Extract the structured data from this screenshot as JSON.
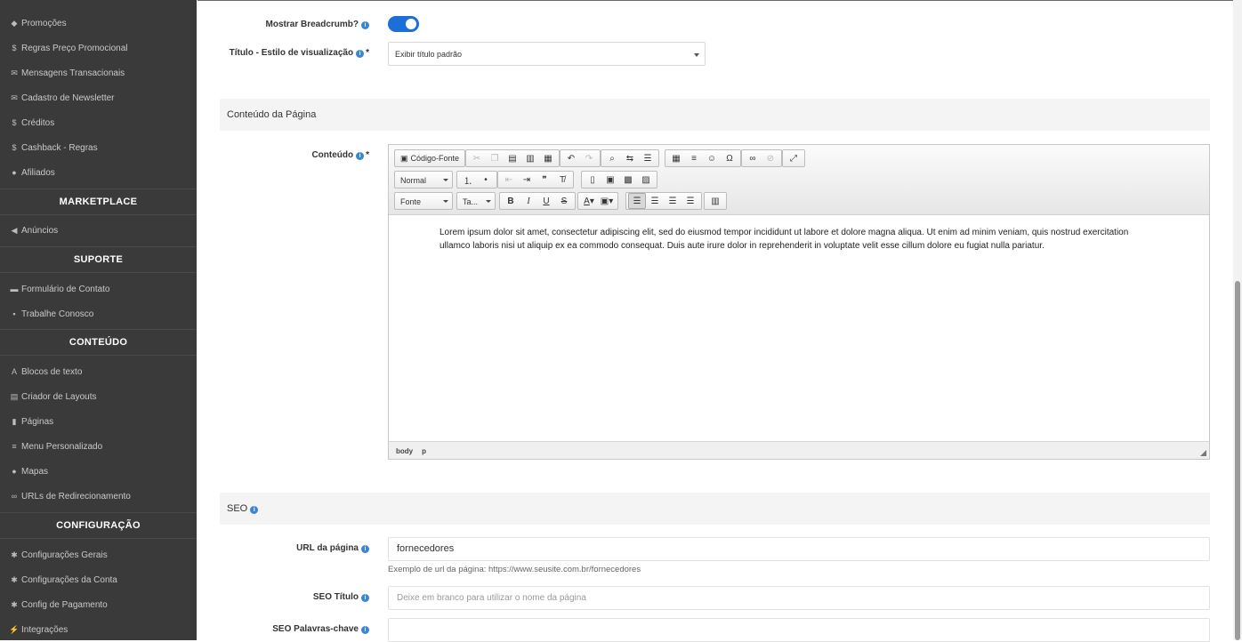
{
  "sidebar": {
    "items_top": [
      {
        "icon": "tag-icon",
        "glyph": "◆",
        "label": "Promoções"
      },
      {
        "icon": "dollar-icon",
        "glyph": "$",
        "label": "Regras Preço Promocional"
      },
      {
        "icon": "envelope-icon",
        "glyph": "✉",
        "label": "Mensagens Transacionais"
      },
      {
        "icon": "envelope-icon",
        "glyph": "✉",
        "label": "Cadastro de Newsletter"
      },
      {
        "icon": "dollar-icon",
        "glyph": "$",
        "label": "Créditos"
      },
      {
        "icon": "dollar-icon",
        "glyph": "$",
        "label": "Cashback - Regras"
      },
      {
        "icon": "user-icon",
        "glyph": "●",
        "label": "Afiliados"
      }
    ],
    "marketplace": {
      "title": "MARKETPLACE",
      "items": [
        {
          "icon": "bullhorn-icon",
          "glyph": "◀",
          "label": "Anúncios"
        }
      ]
    },
    "suporte": {
      "title": "SUPORTE",
      "items": [
        {
          "icon": "comment-icon",
          "glyph": "▬",
          "label": "Formulário de Contato"
        },
        {
          "icon": "briefcase-icon",
          "glyph": "▪",
          "label": "Trabalhe Conosco"
        }
      ]
    },
    "conteudo": {
      "title": "CONTEÚDO",
      "items": [
        {
          "icon": "font-icon",
          "glyph": "A",
          "label": "Blocos de texto"
        },
        {
          "icon": "layout-icon",
          "glyph": "▤",
          "label": "Criador de Layouts"
        },
        {
          "icon": "file-icon",
          "glyph": "▮",
          "label": "Páginas"
        },
        {
          "icon": "menu-icon",
          "glyph": "≡",
          "label": "Menu Personalizado"
        },
        {
          "icon": "map-marker-icon",
          "glyph": "●",
          "label": "Mapas"
        },
        {
          "icon": "link-icon",
          "glyph": "∞",
          "label": "URLs de Redirecionamento"
        }
      ]
    },
    "configuracao": {
      "title": "CONFIGURAÇÃO",
      "items": [
        {
          "icon": "gear-icon",
          "glyph": "✱",
          "label": "Configurações Gerais"
        },
        {
          "icon": "gear-icon",
          "glyph": "✱",
          "label": "Configurações da Conta"
        },
        {
          "icon": "gear-icon",
          "glyph": "✱",
          "label": "Config de Pagamento"
        },
        {
          "icon": "plug-icon",
          "glyph": "⚡",
          "label": "Integrações"
        }
      ]
    }
  },
  "form": {
    "breadcrumb_label": "Mostrar Breadcrumb?",
    "breadcrumb_on": true,
    "title_style_label": "Título - Estilo de visualização",
    "title_style_value": "Exibir título padrão",
    "section_content": "Conteúdo da Página",
    "content_label": "Conteúdo",
    "required_mark": "*",
    "section_seo": "SEO",
    "url_label": "URL da página",
    "url_value": "fornecedores",
    "url_hint": "Exemplo de url da página: https://www.seusite.com.br/fornecedores",
    "seo_title_label": "SEO Título",
    "seo_title_placeholder": "Deixe em branco para utilizar o nome da página",
    "seo_keywords_label": "SEO Palavras-chave",
    "seo_keywords_value": ""
  },
  "editor": {
    "source_label": "Código-Fonte",
    "format_value": "Normal",
    "font_value": "Fonte",
    "size_value": "Ta...",
    "body_text_1": "Lorem ipsum dolor sit amet, consectetur adipiscing elit, sed do eiusmod tempor incididunt ut labore et dolore magna aliqua. Ut enim ad minim veniam, quis nostrud exercitation",
    "body_text_2": "ullamco laboris nisi ut aliquip ex ea commodo consequat. Duis aute irure dolor in reprehenderit in voluptate velit esse cillum dolore eu fugiat nulla pariatur.",
    "path_body": "body",
    "path_p": "p"
  },
  "colors": {
    "sidebar_bg": "#3a3a3a",
    "accent": "#1b6fd6",
    "info": "#3a85d8"
  }
}
